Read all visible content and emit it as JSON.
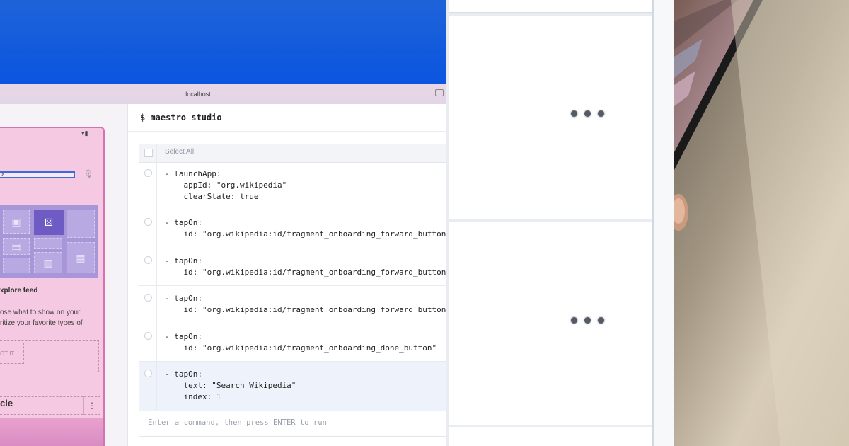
{
  "browser": {
    "url": "localhost"
  },
  "studio": {
    "title": "$ maestro studio",
    "select_all_label": "Select All",
    "commands": [
      {
        "lines": "- launchApp:\n    appId: \"org.wikipedia\"\n    clearState: true",
        "selected": false
      },
      {
        "lines": "- tapOn:\n    id: \"org.wikipedia:id/fragment_onboarding_forward_button\"",
        "selected": false
      },
      {
        "lines": "- tapOn:\n    id: \"org.wikipedia:id/fragment_onboarding_forward_button\"",
        "selected": false
      },
      {
        "lines": "- tapOn:\n    id: \"org.wikipedia:id/fragment_onboarding_forward_button\"",
        "selected": false
      },
      {
        "lines": "- tapOn:\n    id: \"org.wikipedia:id/fragment_onboarding_done_button\"",
        "selected": false
      },
      {
        "lines": "- tapOn:\n    text: \"Search Wikipedia\"\n    index: 1",
        "selected": true
      }
    ],
    "input_placeholder": "Enter a command, then press ENTER to run"
  },
  "phone": {
    "search_text": "ia",
    "explore_title": "xplore feed",
    "explore_desc": "ose what to show on your\nritize your favorite types of",
    "got_it_label": "OT IT",
    "bottom_text": "cle"
  },
  "colors": {
    "accent_blue": "#0b55e0",
    "selection": "#eef3fb",
    "phone_overlay": "#f6c9e3"
  },
  "icons": [
    "wifi-icon",
    "battery-icon",
    "mic-icon",
    "image-icon",
    "dice-icon",
    "card-icon",
    "calendar-icon",
    "news-icon",
    "kebab-menu-icon",
    "window-icon"
  ]
}
